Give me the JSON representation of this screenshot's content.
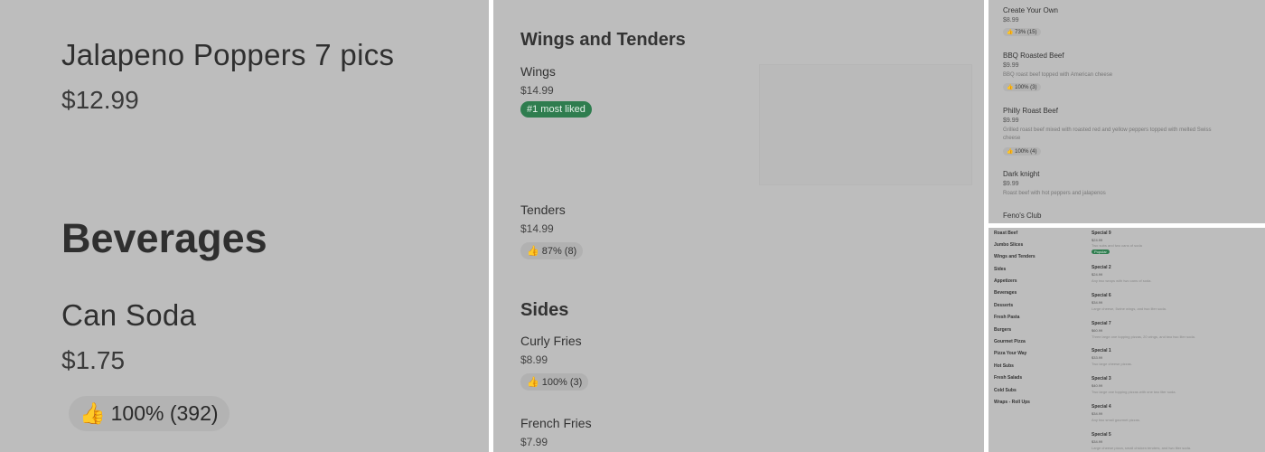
{
  "panel1": {
    "item1_name": "Jalapeno Poppers 7 pics",
    "item1_price": "$12.99",
    "section_title": "Beverages",
    "item2_name": "Can Soda",
    "item2_price": "$1.75",
    "item2_like": "100% (392)"
  },
  "panel2": {
    "section1_title": "Wings and Tenders",
    "wings_name": "Wings",
    "wings_price": "$14.99",
    "wings_badge": "#1 most liked",
    "tenders_name": "Tenders",
    "tenders_price": "$14.99",
    "tenders_like": "87% (8)",
    "section2_title": "Sides",
    "curly_name": "Curly Fries",
    "curly_price": "$8.99",
    "curly_like": "100% (3)",
    "french_name": "French Fries",
    "french_price": "$7.99"
  },
  "panel3": {
    "items": [
      {
        "name": "Create Your Own",
        "price": "$8.99",
        "desc": "",
        "like": "73% (15)"
      },
      {
        "name": "BBQ Roasted Beef",
        "price": "$9.99",
        "desc": "BBQ roast beef topped with American cheese",
        "like": "100% (3)"
      },
      {
        "name": "Philly Roast Beef",
        "price": "$9.99",
        "desc": "Grilled roast beef mixed with roasted red and yellow peppers topped with melted Swiss",
        "desc2": "cheese",
        "like": "100% (4)"
      },
      {
        "name": "Dark knight",
        "price": "$9.99",
        "desc": "Roast beef with hot peppers and jalapenos",
        "like": ""
      },
      {
        "name": "Feno's Club",
        "price": "",
        "desc": "",
        "like": ""
      }
    ]
  },
  "panel4": {
    "nav": [
      "Roast Beef",
      "Jumbo Slices",
      "Wings and Tenders",
      "Sides",
      "Appetizers",
      "Beverages",
      "Desserts",
      "Fresh Pasta",
      "Burgers",
      "Gourmet Pizza",
      "Pizza Your Way",
      "Hot Subs",
      "Fresh Salads",
      "Cold Subs",
      "Wraps - Roll Ups"
    ],
    "specials": [
      {
        "name": "Special 9",
        "price": "$24.99",
        "desc": "Two subs and two cans of soda",
        "badge": "Popular"
      },
      {
        "name": "Special 2",
        "price": "$24.99",
        "desc": "Any two wraps with two cans of soda."
      },
      {
        "name": "Special 6",
        "price": "$34.99",
        "desc": "Large cheese, 5wine wings, and two liter soda."
      },
      {
        "name": "Special 7",
        "price": "$60.99",
        "desc": "Three large one topping pizzas, 20 wings, and two two liter soda."
      },
      {
        "name": "Special 1",
        "price": "$33.99",
        "desc": "Two large cheese pizzas."
      },
      {
        "name": "Special 3",
        "price": "$40.99",
        "desc": "Two large one topping pizzas with one two liter soda."
      },
      {
        "name": "Special 4",
        "price": "$34.99",
        "desc": "Any two small gourmet pizzas."
      },
      {
        "name": "Special 5",
        "price": "$34.99",
        "desc": "Large cheese pizza, small chicken tenders, and two liter soda."
      }
    ]
  }
}
